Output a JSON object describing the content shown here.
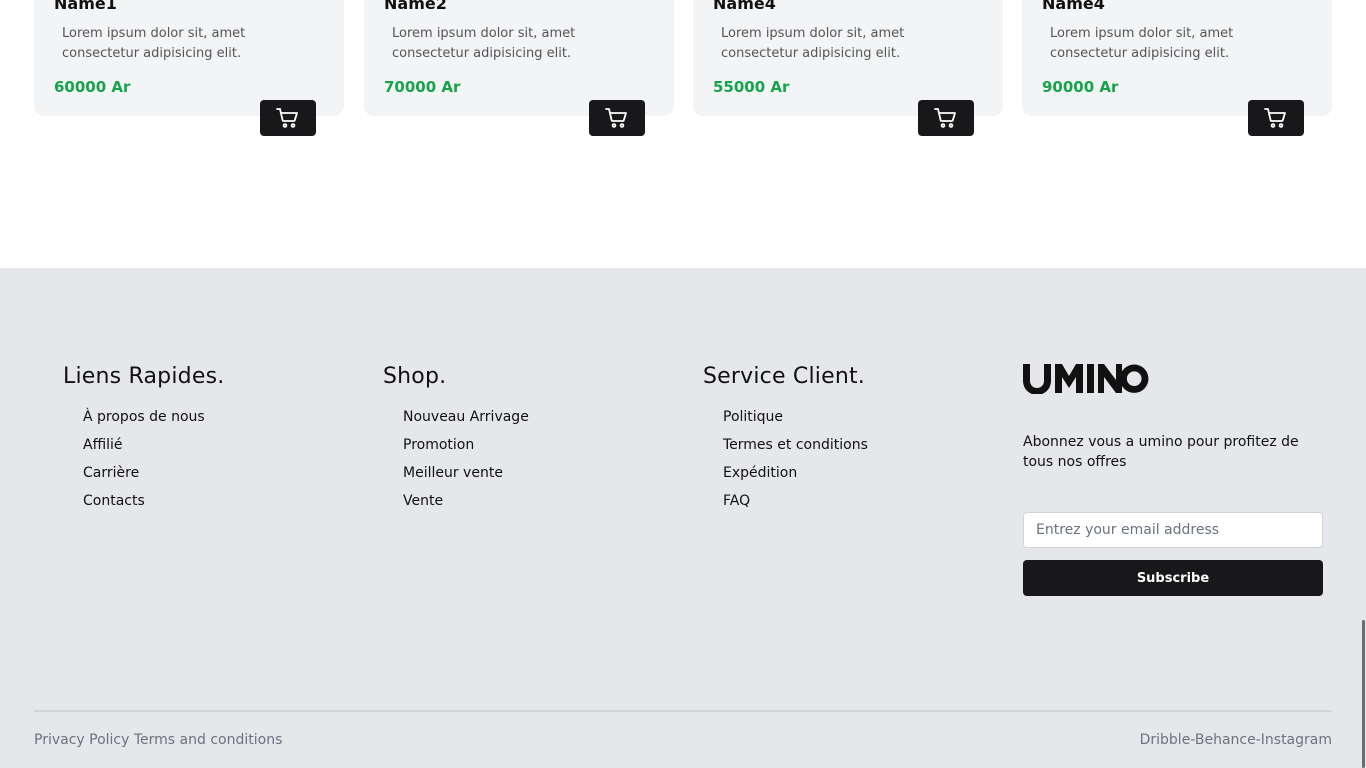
{
  "products": [
    {
      "name": "Name1",
      "description": "Lorem ipsum dolor sit, amet consectetur adipisicing elit.",
      "price": "60000 Ar"
    },
    {
      "name": "Name2",
      "description": "Lorem ipsum dolor sit, amet consectetur adipisicing elit.",
      "price": "70000 Ar"
    },
    {
      "name": "Name4",
      "description": "Lorem ipsum dolor sit, amet consectetur adipisicing elit.",
      "price": "55000 Ar"
    },
    {
      "name": "Name4",
      "description": "Lorem ipsum dolor sit, amet consectetur adipisicing elit.",
      "price": "90000 Ar"
    }
  ],
  "footer": {
    "quick_links": {
      "title": "Liens Rapides.",
      "items": [
        "À propos de nous",
        "Affilié",
        "Carrière",
        "Contacts"
      ]
    },
    "shop": {
      "title": "Shop.",
      "items": [
        "Nouveau Arrivage",
        "Promotion",
        "Meilleur vente",
        "Vente"
      ]
    },
    "service": {
      "title": "Service Client.",
      "items": [
        "Politique",
        "Termes et conditions",
        "Expédition",
        "FAQ"
      ]
    },
    "brand": {
      "logo_text": "UMINO",
      "subscribe_text": "Abonnez vous a umino pour profitez de tous nos offres",
      "email_placeholder": "Entrez your email address",
      "subscribe_label": "Subscribe"
    },
    "legal": {
      "privacy": "Privacy Policy",
      "terms": "Terms and conditions"
    },
    "social": "Dribble-Behance-Instagram"
  },
  "colors": {
    "price": "#16a34a",
    "dark": "#18181b",
    "footer_bg": "#e5e7eb",
    "card_bg": "#f3f4f6"
  },
  "icons": {
    "cart": "shopping-cart-icon"
  }
}
